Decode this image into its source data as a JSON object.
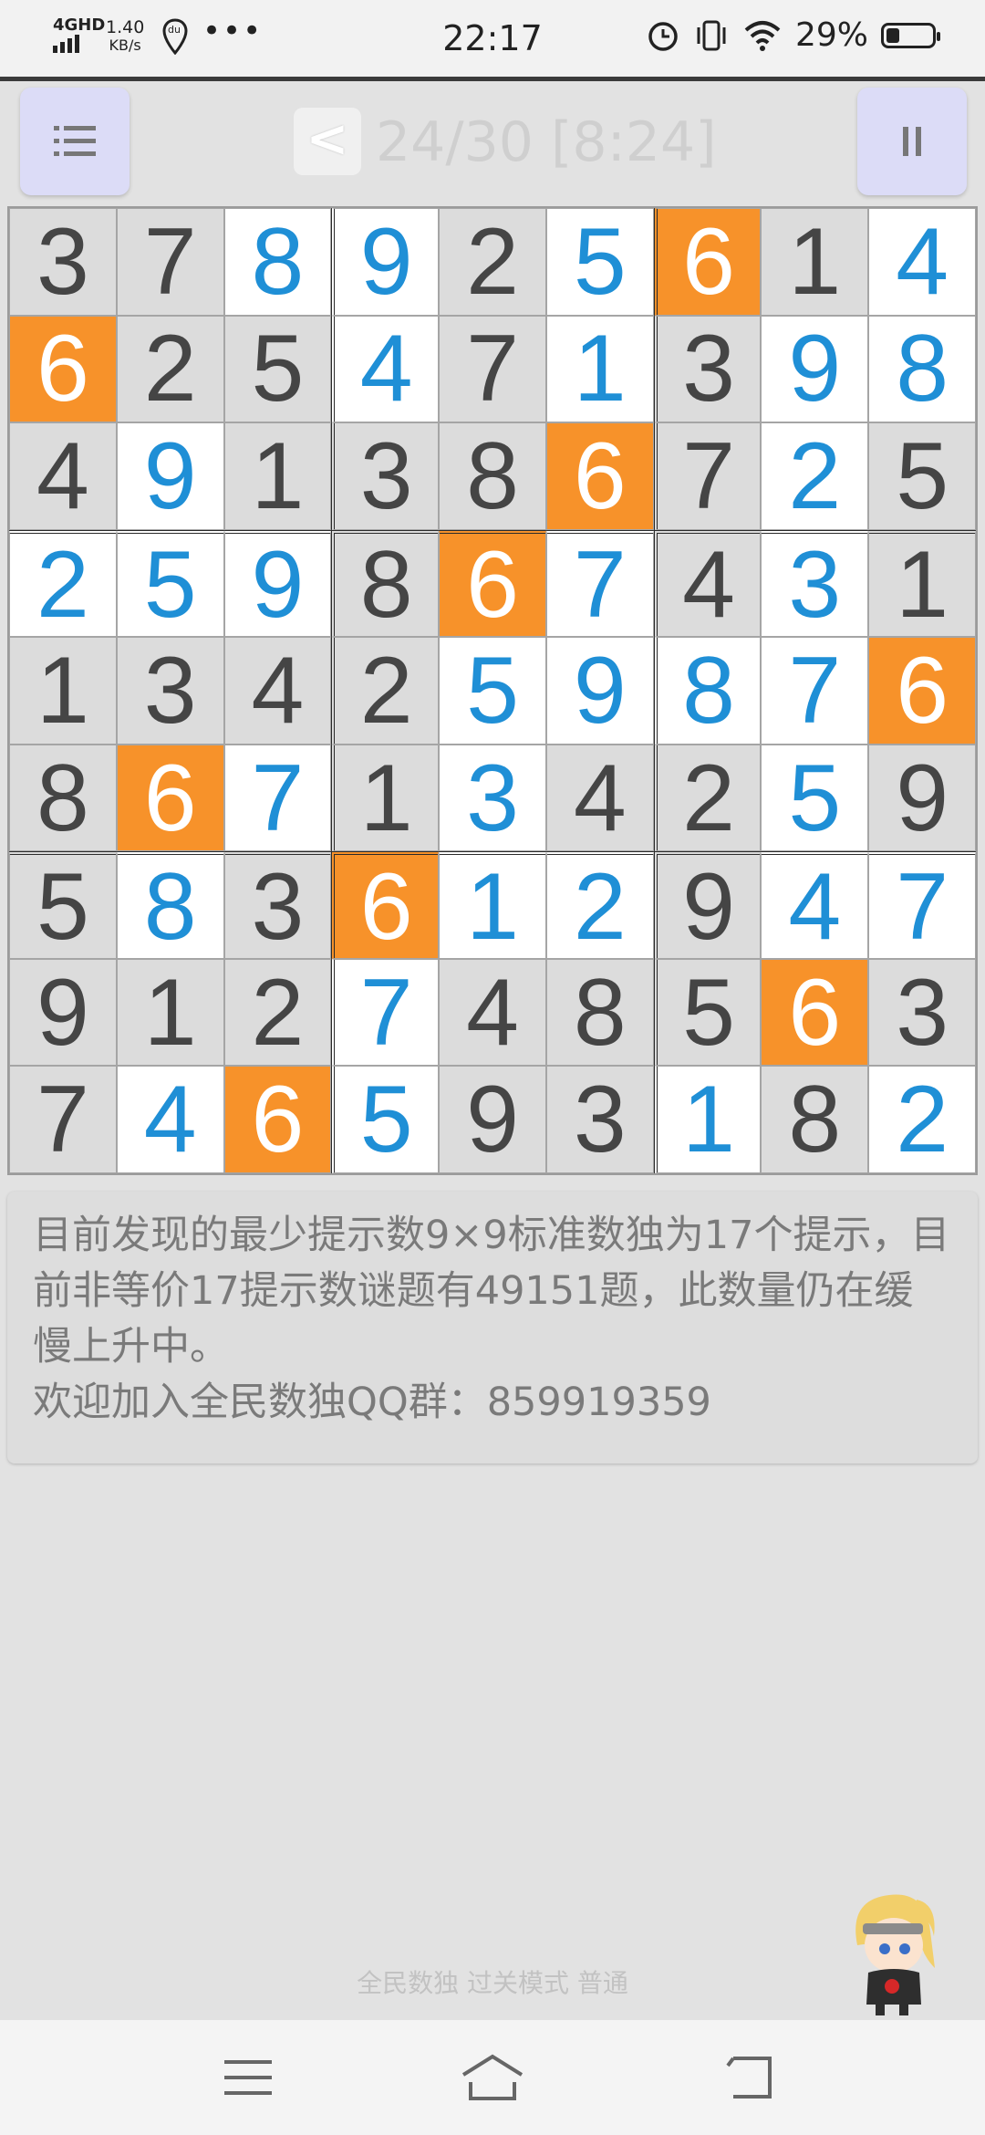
{
  "status_bar": {
    "network": "4GHD",
    "speed_value": "1.40",
    "speed_unit": "KB/s",
    "location_label": "du",
    "more": "•••",
    "time": "22:17",
    "battery_percent": "29%",
    "battery_level": 0.29,
    "icons": [
      "signal-icon",
      "location-pin-icon",
      "alarm-icon",
      "vibrate-icon",
      "wifi-icon",
      "battery-icon"
    ]
  },
  "toolbar": {
    "menu_icon": "list-icon",
    "back_label": "<",
    "level_text": "24/30 [8:24]",
    "pause_icon": "pause-icon"
  },
  "board": {
    "rows": [
      [
        {
          "v": "3",
          "t": "g"
        },
        {
          "v": "7",
          "t": "g"
        },
        {
          "v": "8",
          "t": "e"
        },
        {
          "v": "9",
          "t": "e"
        },
        {
          "v": "2",
          "t": "g"
        },
        {
          "v": "5",
          "t": "e"
        },
        {
          "v": "6",
          "t": "h"
        },
        {
          "v": "1",
          "t": "g"
        },
        {
          "v": "4",
          "t": "e"
        }
      ],
      [
        {
          "v": "6",
          "t": "h"
        },
        {
          "v": "2",
          "t": "g"
        },
        {
          "v": "5",
          "t": "g"
        },
        {
          "v": "4",
          "t": "e"
        },
        {
          "v": "7",
          "t": "g"
        },
        {
          "v": "1",
          "t": "e"
        },
        {
          "v": "3",
          "t": "g"
        },
        {
          "v": "9",
          "t": "e"
        },
        {
          "v": "8",
          "t": "e"
        }
      ],
      [
        {
          "v": "4",
          "t": "g"
        },
        {
          "v": "9",
          "t": "e"
        },
        {
          "v": "1",
          "t": "g"
        },
        {
          "v": "3",
          "t": "g"
        },
        {
          "v": "8",
          "t": "g"
        },
        {
          "v": "6",
          "t": "h"
        },
        {
          "v": "7",
          "t": "g"
        },
        {
          "v": "2",
          "t": "e"
        },
        {
          "v": "5",
          "t": "g"
        }
      ],
      [
        {
          "v": "2",
          "t": "e"
        },
        {
          "v": "5",
          "t": "e"
        },
        {
          "v": "9",
          "t": "e"
        },
        {
          "v": "8",
          "t": "g"
        },
        {
          "v": "6",
          "t": "h"
        },
        {
          "v": "7",
          "t": "e"
        },
        {
          "v": "4",
          "t": "g"
        },
        {
          "v": "3",
          "t": "e"
        },
        {
          "v": "1",
          "t": "g"
        }
      ],
      [
        {
          "v": "1",
          "t": "g"
        },
        {
          "v": "3",
          "t": "g"
        },
        {
          "v": "4",
          "t": "g"
        },
        {
          "v": "2",
          "t": "g"
        },
        {
          "v": "5",
          "t": "e"
        },
        {
          "v": "9",
          "t": "e"
        },
        {
          "v": "8",
          "t": "e"
        },
        {
          "v": "7",
          "t": "e"
        },
        {
          "v": "6",
          "t": "h"
        }
      ],
      [
        {
          "v": "8",
          "t": "g"
        },
        {
          "v": "6",
          "t": "h"
        },
        {
          "v": "7",
          "t": "e"
        },
        {
          "v": "1",
          "t": "g"
        },
        {
          "v": "3",
          "t": "e"
        },
        {
          "v": "4",
          "t": "g"
        },
        {
          "v": "2",
          "t": "g"
        },
        {
          "v": "5",
          "t": "e"
        },
        {
          "v": "9",
          "t": "g"
        }
      ],
      [
        {
          "v": "5",
          "t": "g"
        },
        {
          "v": "8",
          "t": "e"
        },
        {
          "v": "3",
          "t": "g"
        },
        {
          "v": "6",
          "t": "h"
        },
        {
          "v": "1",
          "t": "e"
        },
        {
          "v": "2",
          "t": "e"
        },
        {
          "v": "9",
          "t": "g"
        },
        {
          "v": "4",
          "t": "e"
        },
        {
          "v": "7",
          "t": "e"
        }
      ],
      [
        {
          "v": "9",
          "t": "g"
        },
        {
          "v": "1",
          "t": "g"
        },
        {
          "v": "2",
          "t": "g"
        },
        {
          "v": "7",
          "t": "e"
        },
        {
          "v": "4",
          "t": "g"
        },
        {
          "v": "8",
          "t": "g"
        },
        {
          "v": "5",
          "t": "g"
        },
        {
          "v": "6",
          "t": "h"
        },
        {
          "v": "3",
          "t": "g"
        }
      ],
      [
        {
          "v": "7",
          "t": "g"
        },
        {
          "v": "4",
          "t": "e"
        },
        {
          "v": "6",
          "t": "h"
        },
        {
          "v": "5",
          "t": "e"
        },
        {
          "v": "9",
          "t": "g"
        },
        {
          "v": "3",
          "t": "g"
        },
        {
          "v": "1",
          "t": "e"
        },
        {
          "v": "8",
          "t": "g"
        },
        {
          "v": "2",
          "t": "e"
        }
      ]
    ],
    "colors": {
      "given_bg": "#dcdcdc",
      "given_text": "#454545",
      "entered_bg": "#ffffff",
      "entered_text": "#1f8fd6",
      "highlight_bg": "#f7922a",
      "highlight_text": "#ffffff"
    }
  },
  "info": {
    "line1": "目前发现的最少提示数9×9标准数独为17个提示，目前非等价17提示数谜题有49151题，此数量仍在缓慢上升中。",
    "line2": "欢迎加入全民数独QQ群：859919359"
  },
  "footer": {
    "text": "全民数独 过关模式 普通"
  },
  "nav_bar": {
    "icons": [
      "menu-lines-icon",
      "home-icon",
      "back-arrow-icon"
    ]
  }
}
